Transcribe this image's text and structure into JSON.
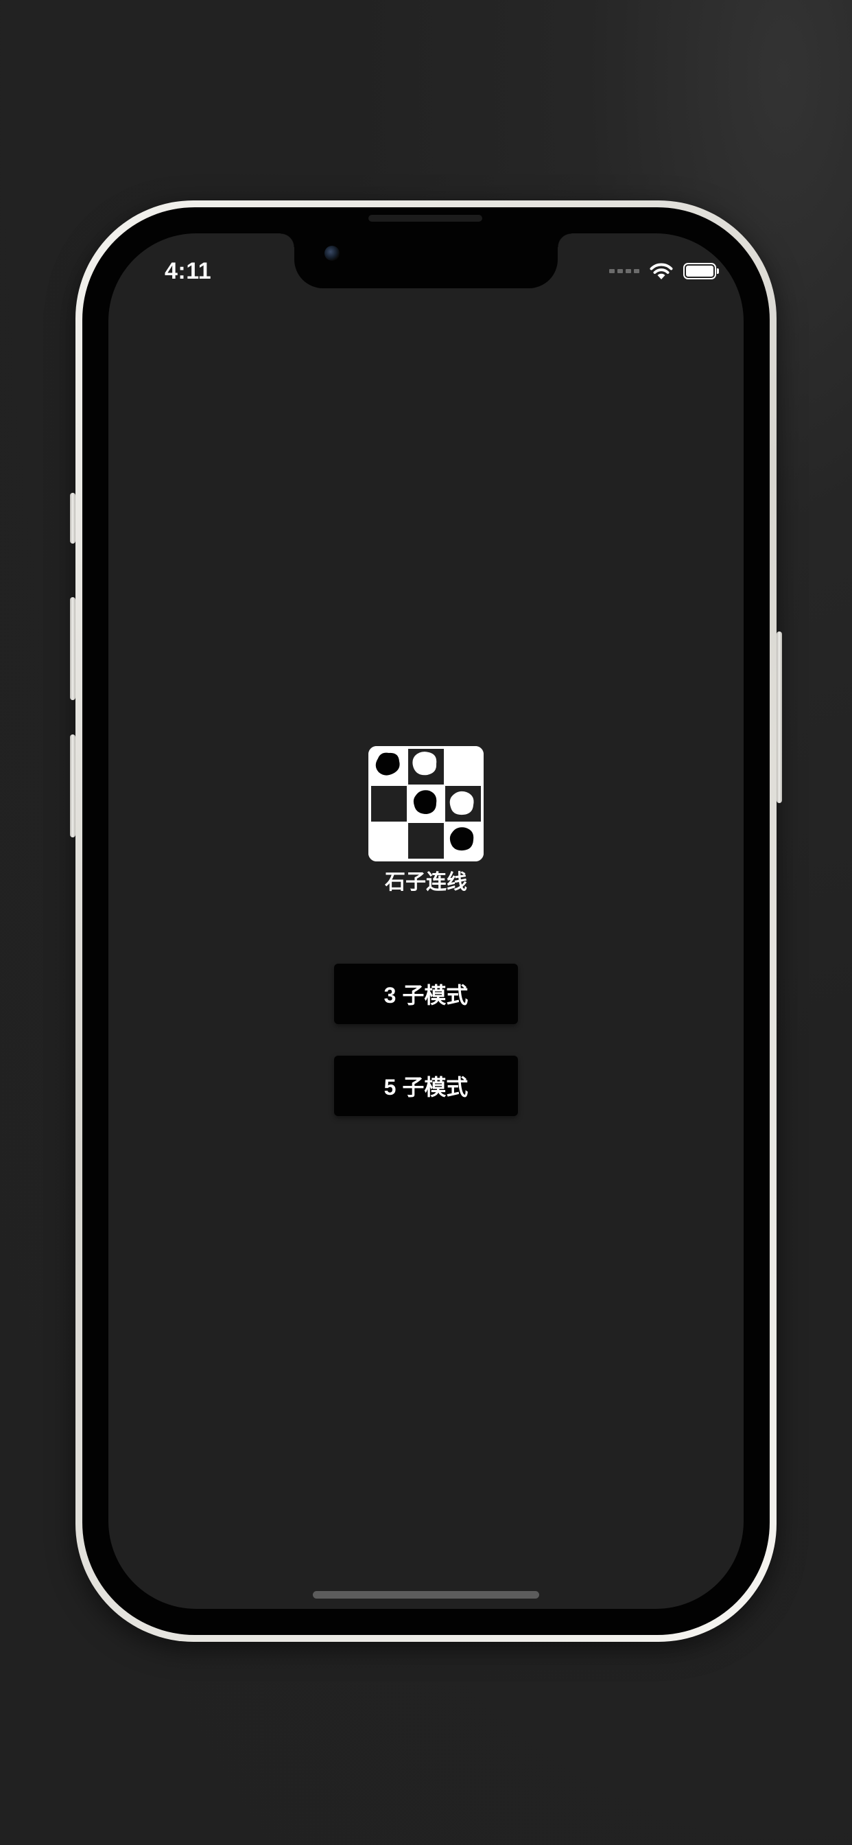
{
  "status_bar": {
    "time": "4:11",
    "icons": [
      "cellular-signal-icon",
      "wifi-icon",
      "battery-icon"
    ]
  },
  "app": {
    "title": "石子连线",
    "logo": {
      "icon": "board-logo-icon",
      "grid": [
        [
          "black",
          "white",
          "empty"
        ],
        [
          "dark",
          "black",
          "white"
        ],
        [
          "empty",
          "dark",
          "black"
        ]
      ]
    },
    "buttons": [
      {
        "label": "3 子模式"
      },
      {
        "label": "5 子模式"
      }
    ]
  },
  "colors": {
    "background": "#212121",
    "button": "#020202",
    "text": "#ffffff"
  }
}
